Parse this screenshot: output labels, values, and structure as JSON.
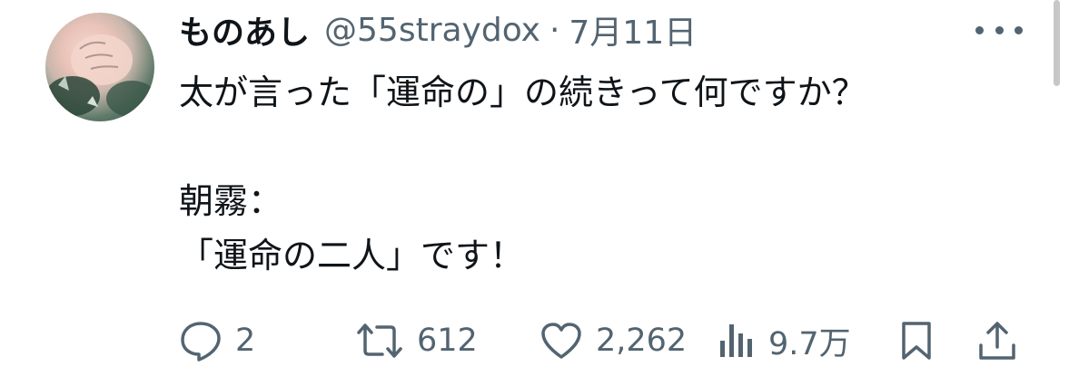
{
  "user": {
    "display_name": "ものあし",
    "handle": "@55straydox",
    "separator": "·",
    "date": "7月11日"
  },
  "icons": {
    "avatar": "avatar-image",
    "more": "more-horizontal-icon",
    "reply": "reply-bubble-icon",
    "retweet": "retweet-icon",
    "like": "heart-icon",
    "views": "views-bar-chart-icon",
    "bookmark": "bookmark-icon",
    "share": "share-upload-icon"
  },
  "tweet": {
    "lines": [
      "太が言った「運命の」の続きって何ですか？",
      "",
      "朝霧：",
      "「運命の二人」です！"
    ]
  },
  "actions": {
    "reply_count": "2",
    "retweet_count": "612",
    "like_count": "2,262",
    "view_count": "9.7万"
  },
  "colors": {
    "text": "#0f1419",
    "secondary": "#536471",
    "background": "#ffffff"
  }
}
